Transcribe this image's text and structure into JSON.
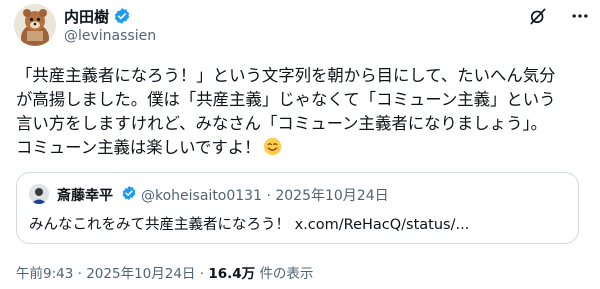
{
  "author": {
    "display_name": "内田樹",
    "handle": "@levinassien",
    "avatar_icon": "bear-mascot-avatar",
    "verified_icon": "verified-badge-icon"
  },
  "actions": {
    "grok_icon": "grok-icon",
    "more_icon": "more-options-icon"
  },
  "body": {
    "lines": [
      "「共産主義者になろう！」という文字列を朝から目にして、たいへん気分",
      "が高揚しました。僕は「共産主義」じゃなくて「コミューン主義」という",
      "言い方をしますけれど、みなさん「コミューン主義者になりましょう」。",
      "コミューン主義は楽しいですよ！"
    ],
    "emoji": "smiling-face-emoji"
  },
  "quote": {
    "display_name": "斎藤幸平",
    "handle": "@koheisaito0131",
    "separator": "·",
    "date": "2025年10月24日",
    "text": "みんなこれをみて共産主義者になろう！ x.com/ReHacQ/status/..."
  },
  "meta": {
    "time": "午前9:43",
    "separator": "·",
    "date": "2025年10月24日",
    "separator2": "·",
    "views": "16.4万",
    "views_label": "件の表示"
  },
  "colors": {
    "text": "#0f1419",
    "secondary": "#536471",
    "verified": "#1d9bf0",
    "border": "#cfd9de"
  }
}
